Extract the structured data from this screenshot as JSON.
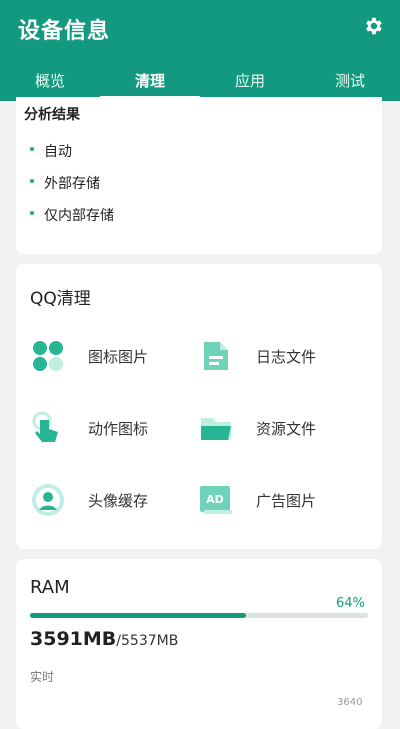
{
  "header": {
    "title": "设备信息",
    "settings_icon": "gear-icon"
  },
  "tabs": [
    {
      "label": "概览"
    },
    {
      "label": "清理",
      "active": true
    },
    {
      "label": "应用"
    },
    {
      "label": "测试"
    }
  ],
  "analysis": {
    "title": "分析结果",
    "items": [
      "自动",
      "外部存储",
      "仅内部存储"
    ]
  },
  "qq_clean": {
    "title": "QQ清理",
    "features": [
      {
        "label": "图标图片",
        "icon": "grid-icon"
      },
      {
        "label": "日志文件",
        "icon": "document-icon"
      },
      {
        "label": "动作图标",
        "icon": "tap-hand-icon"
      },
      {
        "label": "资源文件",
        "icon": "folder-icon"
      },
      {
        "label": "头像缓存",
        "icon": "avatar-icon"
      },
      {
        "label": "广告图片",
        "icon": "ad-icon",
        "icon_text": "AD"
      }
    ]
  },
  "ram": {
    "title": "RAM",
    "percent_label": "64%",
    "percent": 0.64,
    "used": "3591MB",
    "total": "/5537MB",
    "realtime_label": "实时",
    "y_axis_top": "3640"
  },
  "colors": {
    "accent": "#13997f",
    "icon_light": "#bfeee2",
    "icon_dark": "#27b596"
  }
}
